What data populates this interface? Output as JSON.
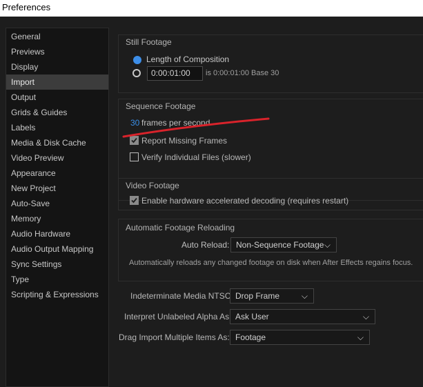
{
  "window": {
    "title": "Preferences"
  },
  "sidebar": {
    "items": [
      {
        "label": "General"
      },
      {
        "label": "Previews"
      },
      {
        "label": "Display"
      },
      {
        "label": "Import",
        "selected": true
      },
      {
        "label": "Output"
      },
      {
        "label": "Grids & Guides"
      },
      {
        "label": "Labels"
      },
      {
        "label": "Media & Disk Cache"
      },
      {
        "label": "Video Preview"
      },
      {
        "label": "Appearance"
      },
      {
        "label": "New Project"
      },
      {
        "label": "Auto-Save"
      },
      {
        "label": "Memory"
      },
      {
        "label": "Audio Hardware"
      },
      {
        "label": "Audio Output Mapping"
      },
      {
        "label": "Sync Settings"
      },
      {
        "label": "Type"
      },
      {
        "label": "Scripting & Expressions"
      }
    ]
  },
  "still_footage": {
    "title": "Still Footage",
    "option_length": "Length of Composition",
    "duration_value": "0:00:01:00",
    "duration_note": "is 0:00:01:00  Base 30"
  },
  "sequence_footage": {
    "title": "Sequence Footage",
    "fps_value": "30",
    "fps_label": "frames per second",
    "report_missing": "Report Missing Frames",
    "verify_files": "Verify Individual Files (slower)"
  },
  "video_footage": {
    "title": "Video Footage",
    "hw_decoding": "Enable hardware accelerated decoding (requires restart)"
  },
  "auto_reload": {
    "title": "Automatic Footage Reloading",
    "label": "Auto Reload:",
    "value": "Non-Sequence Footage",
    "note": "Automatically reloads any changed footage on disk when After Effects regains focus."
  },
  "bottom": {
    "ntsc_label": "Indeterminate Media NTSC:",
    "ntsc_value": "Drop Frame",
    "alpha_label": "Interpret Unlabeled Alpha As:",
    "alpha_value": "Ask User",
    "drag_label": "Drag Import Multiple Items As:",
    "drag_value": "Footage"
  },
  "colors": {
    "accent": "#3a8fe8",
    "annotation_stroke": "#d9232b"
  }
}
